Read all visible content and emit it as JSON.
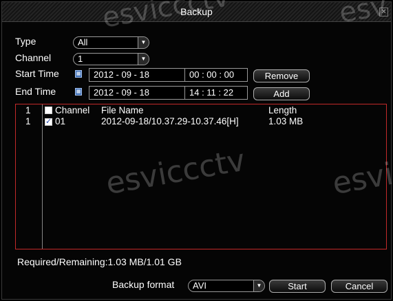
{
  "window": {
    "title": "Backup"
  },
  "form": {
    "type_label": "Type",
    "type_value": "All",
    "channel_label": "Channel",
    "channel_value": "1",
    "start_label": "Start Time",
    "start_date": "2012 - 09 - 18",
    "start_time": "00 : 00 : 00",
    "end_label": "End Time",
    "end_date": "2012 - 09 - 18",
    "end_time": "14 : 11 : 22",
    "remove_label": "Remove",
    "add_label": "Add"
  },
  "list": {
    "header": {
      "index": "1",
      "channel": "Channel",
      "file_name": "File Name",
      "length": "Length"
    },
    "rows": [
      {
        "index": "1",
        "channel": "01",
        "file_name": "2012-09-18/10.37.29-10.37.46[H]",
        "length": "1.03 MB",
        "checked": true
      }
    ]
  },
  "status": {
    "text": "Required/Remaining:1.03 MB/1.01 GB"
  },
  "footer": {
    "format_label": "Backup format",
    "format_value": "AVI",
    "start_label": "Start",
    "cancel_label": "Cancel"
  },
  "watermark": "esviccctv",
  "colors": {
    "list_border": "#c42a2a",
    "icon_blue": "#3d6fb8"
  }
}
